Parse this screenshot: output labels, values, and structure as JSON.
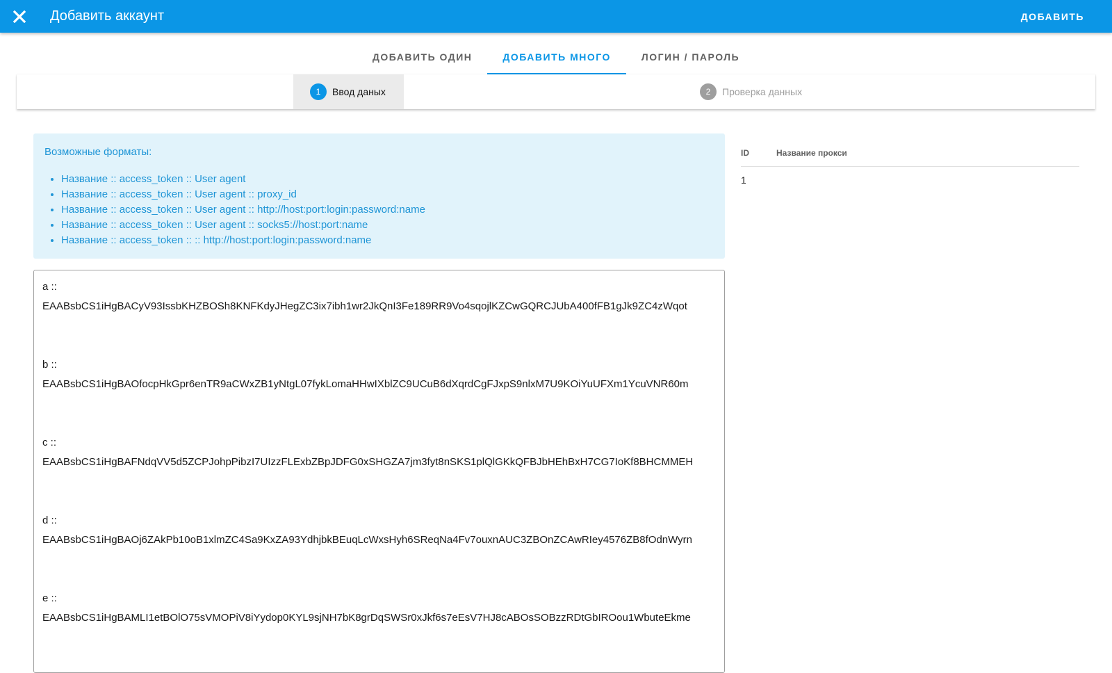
{
  "appbar": {
    "title": "Добавить аккаунт",
    "action_label": "ДОБАВИТЬ",
    "close_icon": "close-icon"
  },
  "tabs": [
    {
      "label": "ДОБАВИТЬ ОДИН",
      "active": false
    },
    {
      "label": "ДОБАВИТЬ МНОГО",
      "active": true
    },
    {
      "label": "ЛОГИН / ПАРОЛЬ",
      "active": false
    }
  ],
  "stepper": {
    "steps": [
      {
        "number": "1",
        "label": "Ввод даных",
        "active": true
      },
      {
        "number": "2",
        "label": "Проверка данных",
        "active": false
      }
    ]
  },
  "info": {
    "title": "Возможные форматы:",
    "formats": [
      "Название :: access_token :: User agent",
      "Название :: access_token :: User agent :: proxy_id",
      "Название :: access_token :: User agent :: http://host:port:login:password:name",
      "Название :: access_token :: User agent :: socks5://host:port:name",
      "Название :: access_token :: :: http://host:port:login:password:name"
    ]
  },
  "editor": {
    "entries": [
      {
        "name": "a ::",
        "token": "EAABsbCS1iHgBACyV93IssbKHZBOSh8KNFKdyJHegZC3ix7ibh1wr2JkQnI3Fe189RR9Vo4sqojlKZCwGQRCJUbA400fFB1gJk9ZC4zWqot"
      },
      {
        "name": "b ::",
        "token": "EAABsbCS1iHgBAOfocpHkGpr6enTR9aCWxZB1yNtgL07fykLomaHHwIXblZC9UCuB6dXqrdCgFJxpS9nlxM7U9KOiYuUFXm1YcuVNR60m"
      },
      {
        "name": "c ::",
        "token": "EAABsbCS1iHgBAFNdqVV5d5ZCPJohpPibzI7UIzzFLExbZBpJDFG0xSHGZA7jm3fyt8nSKS1plQlGKkQFBJbHEhBxH7CG7IoKf8BHCMMEH"
      },
      {
        "name": "d ::",
        "token": "EAABsbCS1iHgBAOj6ZAkPb10oB1xlmZC4Sa9KxZA93YdhjbkBEuqLcWxsHyh6SReqNa4Fv7ouxnAUC3ZBOnZCAwRIey4576ZB8fOdnWyrn"
      },
      {
        "name": "e ::",
        "token": "EAABsbCS1iHgBAMLI1etBOlO75sVMOPiV8iYydop0KYL9sjNH7bK8grDqSWSr0xJkf6s7eEsV7HJ8cABOsSOBzzRDtGbIROou1WbuteEkme"
      }
    ]
  },
  "proxy_table": {
    "headers": {
      "id": "ID",
      "name": "Название прокси"
    },
    "rows": [
      {
        "id": "1",
        "name": ""
      }
    ]
  },
  "colors": {
    "primary": "#0b96e6",
    "info_bg": "#e1f3fb",
    "info_text": "#1f95d6"
  }
}
